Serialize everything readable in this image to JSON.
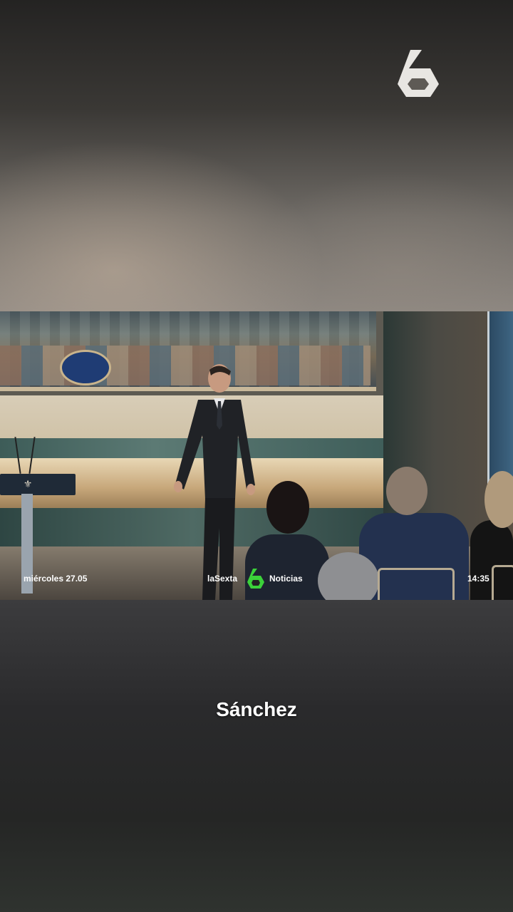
{
  "header": {
    "logo_icon": "lasexta-six-logo-icon"
  },
  "video": {
    "ticker": {
      "date": "miércoles 27.05",
      "brand": "laSexta",
      "brand_icon": "lasexta-six-green-icon",
      "section": "Noticias",
      "time": "14:35"
    }
  },
  "subtitle": {
    "text": "Sánchez"
  },
  "colors": {
    "brand_green": "#3bd13a",
    "logo_white": "#e8e6e2"
  }
}
